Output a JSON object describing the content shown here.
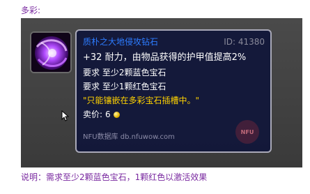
{
  "top_label": "多彩:",
  "icon": {
    "name": "purple-gem-icon"
  },
  "tooltip": {
    "item_name": "质朴之大地侵攻钻石",
    "item_id": "ID: 41380",
    "stat_line": "+32 耐力，由物品获得的护甲值提高2%",
    "requirements": [
      "要求 至少2颗蓝色宝石",
      "要求 至少1颗红色宝石"
    ],
    "quote": "\"只能镶嵌在多彩宝石插槽中。\"",
    "sell_label": "卖价:",
    "sell_value": "6",
    "source": "NFU数据库 db.nfuwow.com",
    "watermark": "NFU"
  },
  "caption": "说明：需求至少2颗蓝色宝石，1颗红色以激活效果",
  "colors": {
    "name_blue": "#2d7cff",
    "quote_yellow": "#ffd200",
    "label_purple": "#7a2aa0",
    "tooltip_bg": "#10163a"
  }
}
